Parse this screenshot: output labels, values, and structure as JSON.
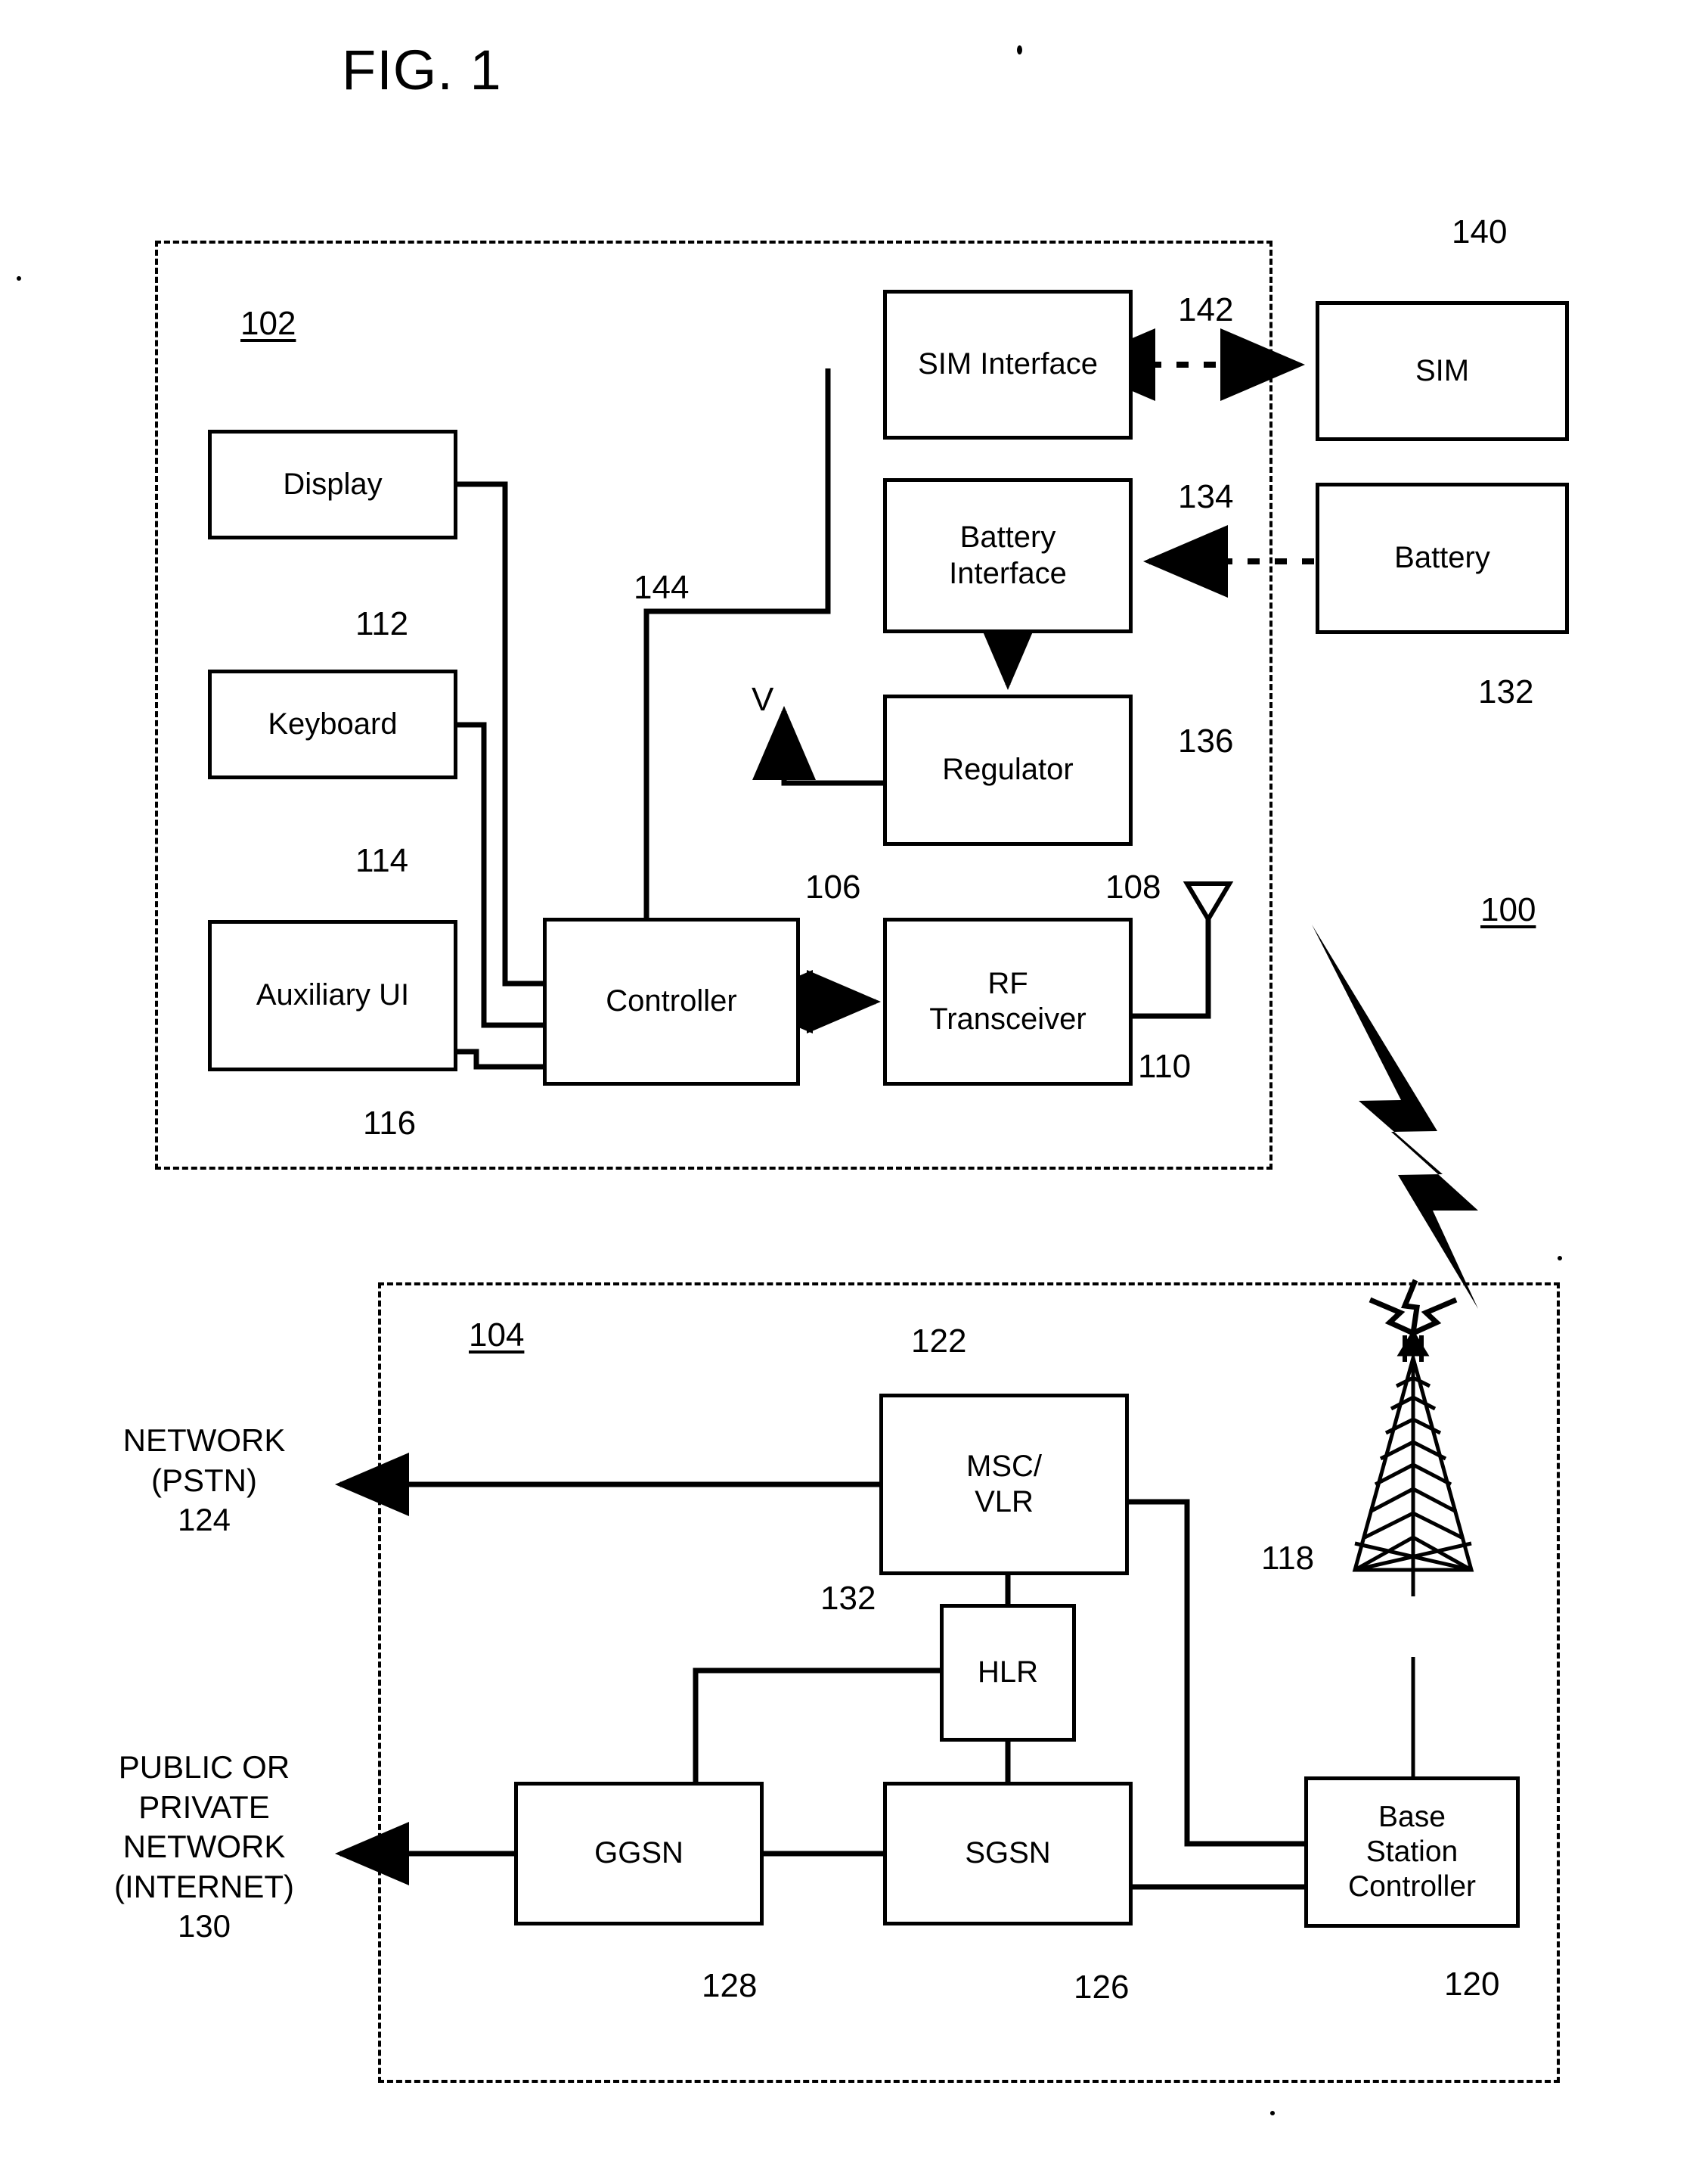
{
  "figure": {
    "title": "FIG. 1",
    "system_ref": "100"
  },
  "mobile_device": {
    "enclosure_ref": "102",
    "blocks": [
      {
        "label": "Display",
        "ref": "112"
      },
      {
        "label": "Keyboard",
        "ref": "114"
      },
      {
        "label": "Auxiliary UI",
        "ref": "116"
      },
      {
        "label": "Controller",
        "ref": "106"
      },
      {
        "label": "RF\nTransceiver",
        "ref": "108"
      },
      {
        "label": "SIM Interface",
        "ref": "142"
      },
      {
        "label": "Battery\nInterface",
        "ref": "134"
      },
      {
        "label": "Regulator",
        "ref": "136"
      }
    ],
    "antenna_ref": "110",
    "bus_ref": "144",
    "voltage_label": "V"
  },
  "external_components": [
    {
      "label": "SIM",
      "ref": "140"
    },
    {
      "label": "Battery",
      "ref": "132"
    }
  ],
  "network": {
    "enclosure_ref": "104",
    "blocks": [
      {
        "label": "MSC/\nVLR",
        "ref": "122"
      },
      {
        "label": "HLR",
        "ref": "132"
      },
      {
        "label": "GGSN",
        "ref": "128"
      },
      {
        "label": "SGSN",
        "ref": "126"
      },
      {
        "label": "Base\nStation\nController",
        "ref": "120"
      }
    ],
    "tower_ref": "118",
    "external_networks": [
      {
        "label": "NETWORK\n(PSTN)\n124"
      },
      {
        "label": "PUBLIC OR\nPRIVATE\nNETWORK\n(INTERNET)\n130"
      }
    ]
  }
}
